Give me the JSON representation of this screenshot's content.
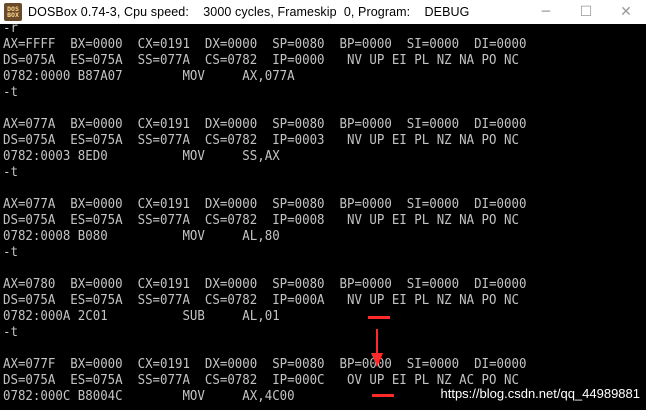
{
  "window": {
    "icon_text": [
      "DOS",
      "BOX"
    ],
    "title": "DOSBox 0.74-3, Cpu speed:    3000 cycles, Frameskip  0, Program:    DEBUG",
    "minimize_glyph": "─",
    "maximize_glyph": "☐",
    "close_glyph": "✕"
  },
  "terminal": {
    "lines": [
      "-r",
      "AX=FFFF  BX=0000  CX=0191  DX=0000  SP=0080  BP=0000  SI=0000  DI=0000",
      "DS=075A  ES=075A  SS=077A  CS=0782  IP=0000   NV UP EI PL NZ NA PO NC",
      "0782:0000 B87A07        MOV     AX,077A",
      "-t",
      "",
      "AX=077A  BX=0000  CX=0191  DX=0000  SP=0080  BP=0000  SI=0000  DI=0000",
      "DS=075A  ES=075A  SS=077A  CS=0782  IP=0003   NV UP EI PL NZ NA PO NC",
      "0782:0003 8ED0          MOV     SS,AX",
      "-t",
      "",
      "AX=077A  BX=0000  CX=0191  DX=0000  SP=0080  BP=0000  SI=0000  DI=0000",
      "DS=075A  ES=075A  SS=077A  CS=0782  IP=0008   NV UP EI PL NZ NA PO NC",
      "0782:0008 B080          MOV     AL,80",
      "-t",
      "",
      "AX=0780  BX=0000  CX=0191  DX=0000  SP=0080  BP=0000  SI=0000  DI=0000",
      "DS=075A  ES=075A  SS=077A  CS=0782  IP=000A   NV UP EI PL NZ NA PO NC",
      "0782:000A 2C01          SUB     AL,01",
      "-t",
      "",
      "AX=077F  BX=0000  CX=0191  DX=0000  SP=0080  BP=0000  SI=0000  DI=0000",
      "DS=075A  ES=075A  SS=077A  CS=0782  IP=000C   OV UP EI PL NZ AC PO NC",
      "0782:000C B8004C        MOV     AX,4C00"
    ]
  },
  "annotation_color": "#ff2a2a",
  "watermark": "https://blog.csdn.net/qq_44989881"
}
